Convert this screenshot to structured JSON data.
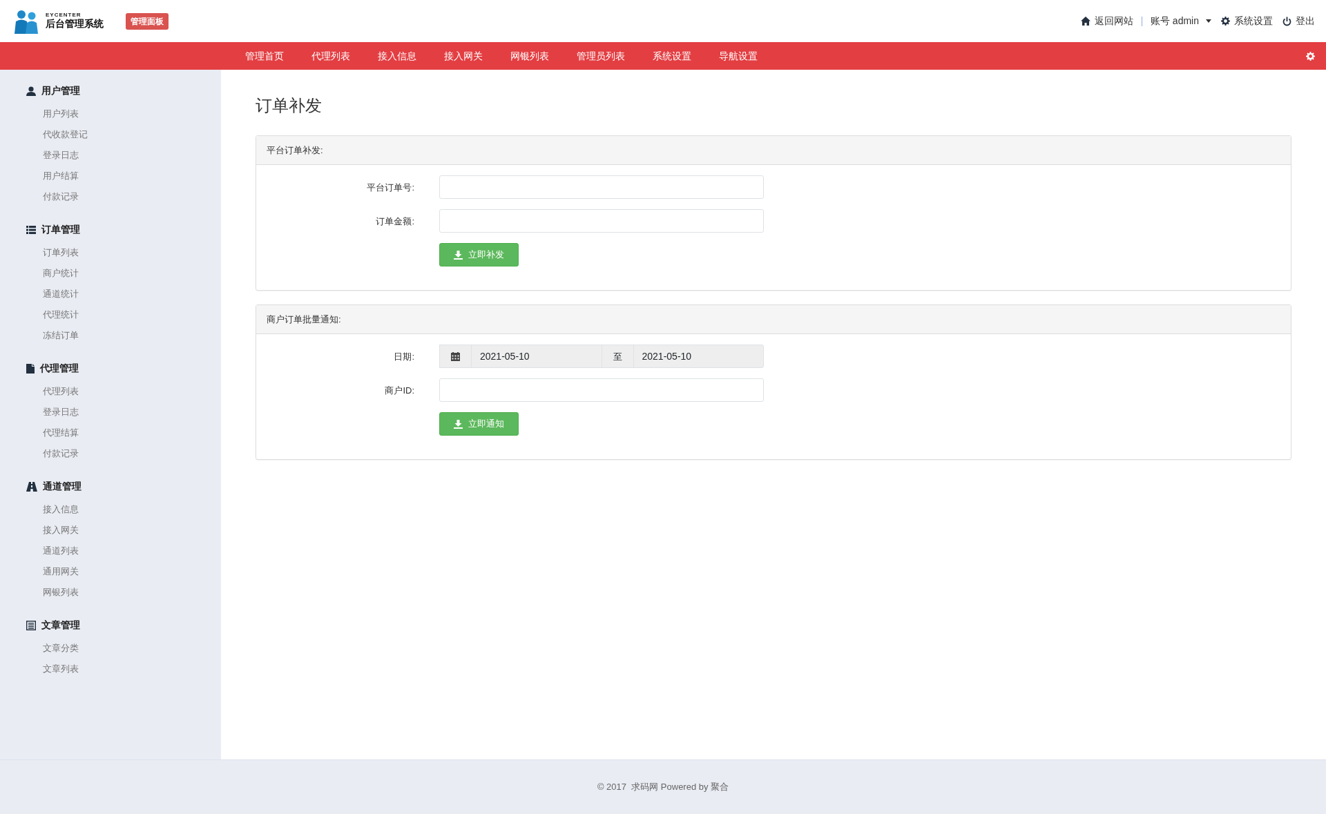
{
  "header": {
    "logo_caption": "EYCENTER",
    "logo_title": "后台管理系统",
    "badge": "管理面板",
    "links": [
      {
        "kind": "home",
        "label": "返回网站"
      },
      {
        "kind": "account",
        "label": "账号 admin"
      },
      {
        "kind": "settings",
        "label": "系统设置"
      },
      {
        "kind": "logout",
        "label": "登出"
      }
    ]
  },
  "nav": {
    "items": [
      "管理首页",
      "代理列表",
      "接入信息",
      "接入网关",
      "网银列表",
      "管理员列表",
      "系统设置",
      "导航设置"
    ]
  },
  "sidebar": {
    "groups": [
      {
        "kind": "user",
        "title": "用户管理",
        "items": [
          "用户列表",
          "代收款登记",
          "登录日志",
          "用户结算",
          "付款记录"
        ]
      },
      {
        "kind": "list",
        "title": "订单管理",
        "items": [
          "订单列表",
          "商户统计",
          "通道统计",
          "代理统计",
          "冻结订单"
        ]
      },
      {
        "kind": "file",
        "title": "代理管理",
        "items": [
          "代理列表",
          "登录日志",
          "代理结算",
          "付款记录"
        ]
      },
      {
        "kind": "road",
        "title": "通道管理",
        "items": [
          "接入信息",
          "接入网关",
          "通道列表",
          "通用网关",
          "网银列表"
        ]
      },
      {
        "kind": "article",
        "title": "文章管理",
        "items": [
          "文章分类",
          "文章列表"
        ]
      }
    ]
  },
  "page_title": "订单补发",
  "panels": [
    {
      "title": "平台订单补发:",
      "fields": [
        {
          "kind": "text",
          "label": "平台订单号:"
        },
        {
          "kind": "text",
          "label": "订单金额:"
        }
      ],
      "button": "立即补发"
    },
    {
      "title": "商户订单批量通知:",
      "fields": [
        {
          "kind": "date_range",
          "label": "日期:",
          "from": "2021-05-10",
          "separator": "至",
          "to": "2021-05-10"
        },
        {
          "kind": "text",
          "label": "商户ID:"
        }
      ],
      "button": "立即通知"
    }
  ],
  "footer": "© 2017  求码网 Powered by 聚合"
}
